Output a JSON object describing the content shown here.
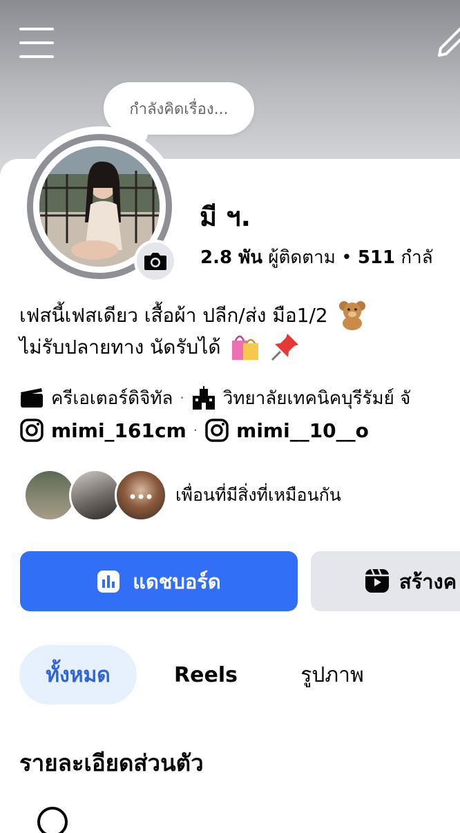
{
  "status_bubble": "กำลังคิดเรื่อง...",
  "profile": {
    "name": "มี ฯ.",
    "followers_count": "2.8 พัน",
    "followers_label": "ผู้ติดตาม",
    "following_count": "511",
    "following_label": "กำลั"
  },
  "bio": {
    "line1": "เฟสนี้เฟสเดียว เสื้อผ้า ปลีก/ส่ง มือ1/2",
    "line2": "ไม่รับปลายทาง นัดรับได้"
  },
  "info": {
    "category": "ครีเอเตอร์ดิจิทัล",
    "school": "วิทยาลัยเทคนิคบุรีรัมย์ จั",
    "instagram1": "mimi_161cm",
    "instagram2": "mimi__10__o"
  },
  "mutual": {
    "label": "เพื่อนที่มีสิ่งที่เหมือนกัน"
  },
  "actions": {
    "primary": "แดชบอร์ด",
    "secondary": "สร้างค"
  },
  "tabs": [
    "ทั้งหมด",
    "Reels",
    "รูปภาพ"
  ],
  "section": {
    "title": "รายละเอียดส่วนตัว"
  },
  "colors": {
    "accent": "#316ff6",
    "tab_active_bg": "#e7f0fd",
    "tab_active_text": "#2d64d8"
  }
}
